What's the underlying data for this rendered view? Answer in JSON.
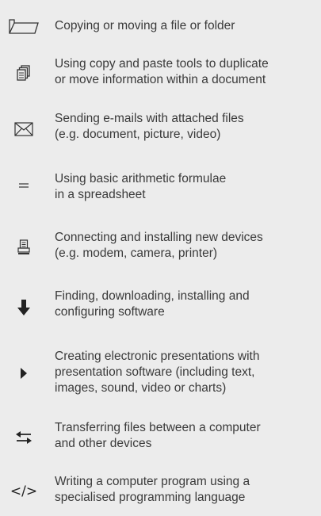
{
  "items": [
    {
      "icon": "folder-icon",
      "label": "Copying or moving a file or folder"
    },
    {
      "icon": "copy-documents-icon",
      "label": "Using copy and paste tools to duplicate\nor move information within a document"
    },
    {
      "icon": "envelope-icon",
      "label": "Sending e-mails with attached files\n(e.g. document, picture, video)"
    },
    {
      "icon": "equals-icon",
      "label": "Using basic arithmetic formulae\nin a spreadsheet"
    },
    {
      "icon": "printer-icon",
      "label": "Connecting and installing new devices\n(e.g. modem, camera, printer)"
    },
    {
      "icon": "download-arrow-icon",
      "label": "Finding, downloading, installing and\nconfiguring software"
    },
    {
      "icon": "play-icon",
      "label": "Creating electronic presentations with\npresentation software (including text,\nimages, sound, video or charts)"
    },
    {
      "icon": "transfer-arrows-icon",
      "label": "Transferring files between a computer\nand other devices"
    },
    {
      "icon": "code-icon",
      "code_glyph": "</>",
      "label": "Writing a computer program using a\nspecialised programming language"
    }
  ]
}
